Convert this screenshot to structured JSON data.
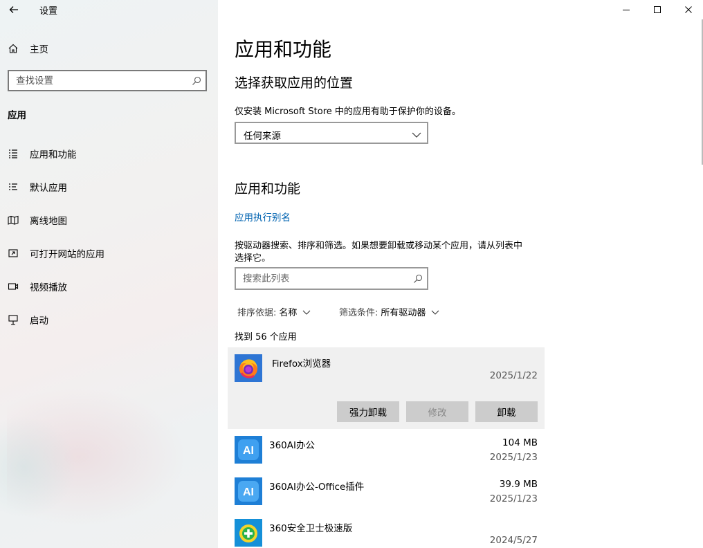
{
  "titlebar": {
    "title": "设置",
    "controls": [
      "minimize-icon",
      "maximize-icon",
      "close-icon"
    ]
  },
  "sidebar": {
    "home_label": "主页",
    "search_placeholder": "查找设置",
    "section": "应用",
    "items": [
      {
        "label": "应用和功能",
        "icon": "apps-features-icon"
      },
      {
        "label": "默认应用",
        "icon": "default-apps-icon"
      },
      {
        "label": "离线地图",
        "icon": "offline-maps-icon"
      },
      {
        "label": "可打开网站的应用",
        "icon": "apps-for-websites-icon"
      },
      {
        "label": "视频播放",
        "icon": "video-playback-icon"
      },
      {
        "label": "启动",
        "icon": "startup-icon"
      }
    ]
  },
  "main": {
    "title": "应用和功能",
    "install_section": {
      "heading": "选择获取应用的位置",
      "description": "仅安装 Microsoft Store 中的应用有助于保护你的设备。",
      "dropdown_value": "任何来源"
    },
    "apps_section": {
      "heading": "应用和功能",
      "alias_link": "应用执行别名",
      "description_line1": "按驱动器搜索、排序和筛选。如果想要卸载或移动某个应用，请从列表中",
      "description_line2": "选择它。",
      "search_placeholder": "搜索此列表",
      "sort_label": "排序依据:",
      "sort_value": "名称",
      "filter_label": "筛选条件:",
      "filter_value": "所有驱动器",
      "count_text": "找到 56 个应用"
    },
    "apps": [
      {
        "name": "Firefox浏览器",
        "size": "",
        "date": "2025/1/22",
        "selected": true,
        "icon": "firefox-icon"
      },
      {
        "name": "360AI办公",
        "size": "104 MB",
        "date": "2025/1/23",
        "icon": "360ai-office-icon"
      },
      {
        "name": "360AI办公-Office插件",
        "size": "39.9 MB",
        "date": "2025/1/23",
        "icon": "360ai-office-plugin-icon"
      },
      {
        "name": "360安全卫士极速版",
        "size": "",
        "date": "2024/5/27",
        "icon": "360-security-icon"
      }
    ],
    "selected_actions": {
      "force_uninstall": "强力卸载",
      "modify": "修改",
      "uninstall": "卸载"
    }
  },
  "colors": {
    "link": "#0063b1",
    "button_bg": "#cccccc",
    "selected_bg": "#f0f0f0",
    "ai_icon_bg": "#1e7fd6",
    "security_icon_bg": "#1590d8"
  }
}
